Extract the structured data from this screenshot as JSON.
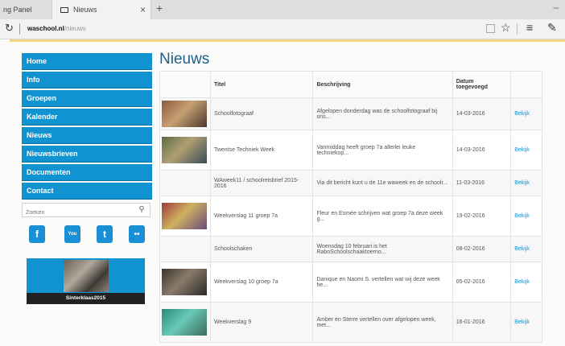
{
  "browser": {
    "inactive_tab_label": "ng Panel",
    "active_tab_label": "Nieuws",
    "close_glyph": "×",
    "new_tab_glyph": "+",
    "minimize_glyph": "–",
    "address_host": "waschool.nl",
    "address_path": "/nieuws"
  },
  "nav": {
    "items": [
      {
        "label": "Home"
      },
      {
        "label": "Info"
      },
      {
        "label": "Groepen"
      },
      {
        "label": "Kalender"
      },
      {
        "label": "Nieuws"
      },
      {
        "label": "Nieuwsbrieven"
      },
      {
        "label": "Documenten"
      },
      {
        "label": "Contact"
      }
    ],
    "accent_color": "#1193d1"
  },
  "search": {
    "placeholder": "Zoeken"
  },
  "social": {
    "facebook_glyph": "f",
    "youtube_glyph": "You",
    "twitter_glyph": "t",
    "flickr_glyph": "••"
  },
  "banner": {
    "caption": "Sinterklaas2015"
  },
  "main": {
    "title": "Nieuws",
    "columns": {
      "titel": "Titel",
      "beschrijving": "Beschrijving",
      "datum_line1": "Datum",
      "datum_line2": "toegevoegd"
    },
    "rows": [
      {
        "title": "Schoolfotograaf",
        "desc": "Afgelopen donderdag was de schoolfotograaf bij ons...",
        "date": "14-03-2016",
        "link": "Bekijk",
        "has_image": true,
        "image_colors": [
          "#8a5a3c",
          "#c8a074",
          "#4a3a2e"
        ]
      },
      {
        "title": "Twentse Techniek Week",
        "desc": "Vanmiddag heeft groep 7a allerlei leuke techniekop...",
        "date": "14-03-2016",
        "link": "Bekijk",
        "has_image": true,
        "image_colors": [
          "#5c6b4a",
          "#b0a070",
          "#3a4a5c"
        ]
      },
      {
        "title": "WAweek11 / schoolreisbrief 2015-2016",
        "desc": "Via dit bericht kunt u de 11e waweek en de schoolr...",
        "date": "11-03-2016",
        "link": "Bekijk",
        "has_image": false,
        "image_colors": []
      },
      {
        "title": "Weekverslag 11 groep 7a",
        "desc": "Fleur en Esmée schrijven wat groep 7a deze week g...",
        "date": "19-02-2016",
        "link": "Bekijk",
        "has_image": true,
        "image_colors": [
          "#9c3a3a",
          "#d0b060",
          "#6a4a7a"
        ]
      },
      {
        "title": "Schoolschaken",
        "desc": "Woensdag 10 februari is het RaboSchoolschaaktoerno...",
        "date": "08-02-2016",
        "link": "Bekijk",
        "has_image": false,
        "image_colors": []
      },
      {
        "title": "Weekverslag 10 groep 7a",
        "desc": "Danique en Naomi S. vertellen wat wij deze week he...",
        "date": "05-02-2016",
        "link": "Bekijk",
        "has_image": true,
        "image_colors": [
          "#3a3530",
          "#8a7a68",
          "#2a2a2a"
        ]
      },
      {
        "title": "Weekverslag 9",
        "desc": "Amber en Sterre vertellen over afgelopen week, met...",
        "date": "16-01-2016",
        "link": "Bekijk",
        "has_image": true,
        "image_colors": [
          "#2a8a7a",
          "#6acaba",
          "#3a6a5a"
        ]
      }
    ]
  }
}
